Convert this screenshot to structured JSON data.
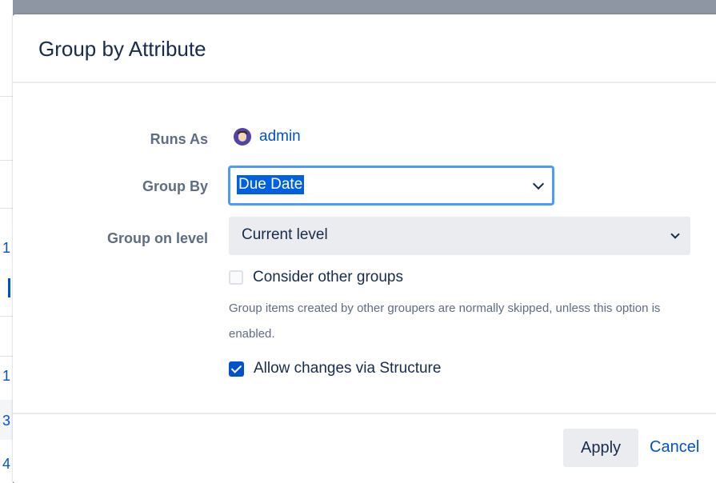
{
  "dialog": {
    "title": "Group by Attribute"
  },
  "form": {
    "runs_as": {
      "label": "Runs As",
      "user": "admin",
      "avatar_icon": "user-avatar-icon"
    },
    "group_by": {
      "label": "Group By",
      "selected": "Due Date"
    },
    "group_on_level": {
      "label": "Group on level",
      "selected": "Current level"
    },
    "consider_other_groups": {
      "label": "Consider other groups",
      "checked": false,
      "help": "Group items created by other groupers are normally skipped, unless this option is enabled."
    },
    "allow_changes": {
      "label": "Allow changes via Structure",
      "checked": true
    }
  },
  "footer": {
    "apply_label": "Apply",
    "cancel_label": "Cancel"
  },
  "background": {
    "marks": [
      "1",
      "1",
      "3",
      "4"
    ]
  },
  "colors": {
    "accent": "#0052cc",
    "focus": "#4c9aff",
    "muted_text": "#5e6c84",
    "field_bg": "#ebecf0"
  }
}
